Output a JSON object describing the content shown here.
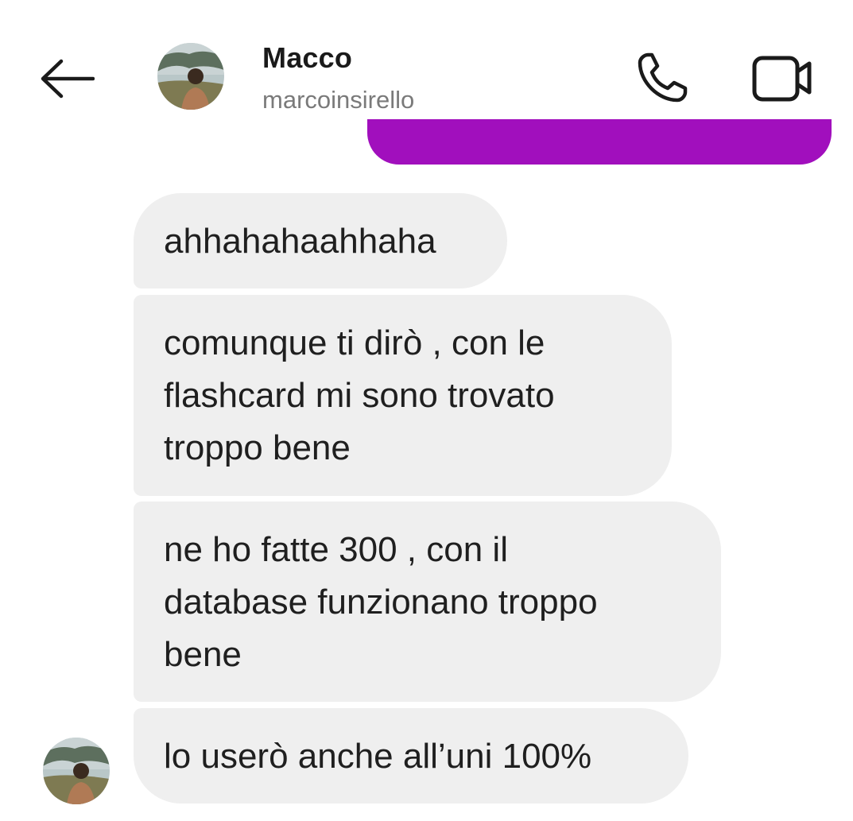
{
  "header": {
    "contact_name": "Macco",
    "contact_username": "marcoinsirello",
    "icons": {
      "back": "back-arrow-icon",
      "call": "phone-icon",
      "video": "video-camera-icon"
    }
  },
  "colors": {
    "sent_bubble": "#a10fbd",
    "received_bubble": "#efefef",
    "username_text": "#7a7a7a"
  },
  "messages": [
    {
      "direction": "received",
      "text": "ahhahahaahhaha"
    },
    {
      "direction": "received",
      "text": "comunque ti dirò , con le\nflashcard mi sono trovato\ntroppo bene"
    },
    {
      "direction": "received",
      "text": "ne ho fatte 300 , con il\ndatabase funzionano troppo\nbene"
    },
    {
      "direction": "received",
      "text": "lo userò anche all’uni 100%"
    }
  ]
}
